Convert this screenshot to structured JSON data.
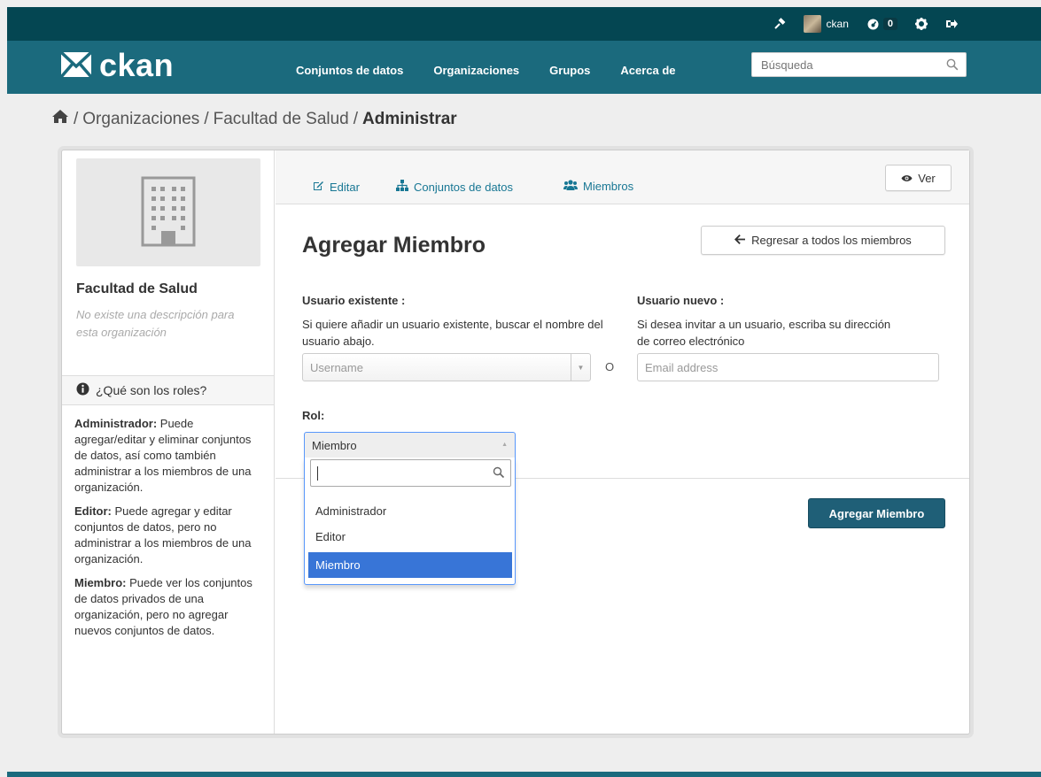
{
  "account": {
    "username": "ckan",
    "activity_count": "0"
  },
  "masthead": {
    "logo_text": "ckan",
    "nav": [
      "Conjuntos de datos",
      "Organizaciones",
      "Grupos",
      "Acerca de"
    ],
    "search_placeholder": "Búsqueda"
  },
  "breadcrumb": {
    "items": [
      "Organizaciones",
      "Facultad de Salud"
    ],
    "active": "Administrar",
    "separator": "/"
  },
  "sidebar": {
    "org_title": "Facultad de Salud",
    "org_description": "No existe una descripción para esta organización",
    "roles_heading": "¿Qué son los roles?",
    "roles": [
      {
        "name": "Administrador:",
        "desc": " Puede agregar/editar y eliminar conjuntos de datos, así como también administrar a los miembros de una organización."
      },
      {
        "name": "Editor:",
        "desc": " Puede agregar y editar conjuntos de datos, pero no administrar a los miembros de una organización."
      },
      {
        "name": "Miembro:",
        "desc": " Puede ver los conjuntos de datos privados de una organización, pero no agregar nuevos conjuntos de datos."
      }
    ]
  },
  "tabs": {
    "edit": "Editar",
    "datasets": "Conjuntos de datos",
    "members": "Miembros",
    "view_button": "Ver"
  },
  "form": {
    "heading": "Agregar Miembro",
    "back_button": "Regresar a todos los miembros",
    "existing_user_label": "Usuario existente :",
    "existing_user_help": "Si quiere añadir un usuario existente, buscar el nombre del usuario abajo.",
    "username_placeholder": "Username",
    "or_text": "O",
    "new_user_label": "Usuario nuevo :",
    "new_user_help": "Si desea invitar a un usuario, escriba su dirección de correo electrónico",
    "email_placeholder": "Email address",
    "role_label": "Rol:",
    "role_selected": "Miembro",
    "role_options": [
      "Administrador",
      "Editor",
      "Miembro"
    ],
    "submit_button": "Agregar Miembro"
  },
  "colors": {
    "account_bar": "#044652",
    "masthead": "#1b6a7d",
    "link": "#187794",
    "submit": "#1f5f77",
    "option_highlight": "#3875d7"
  }
}
